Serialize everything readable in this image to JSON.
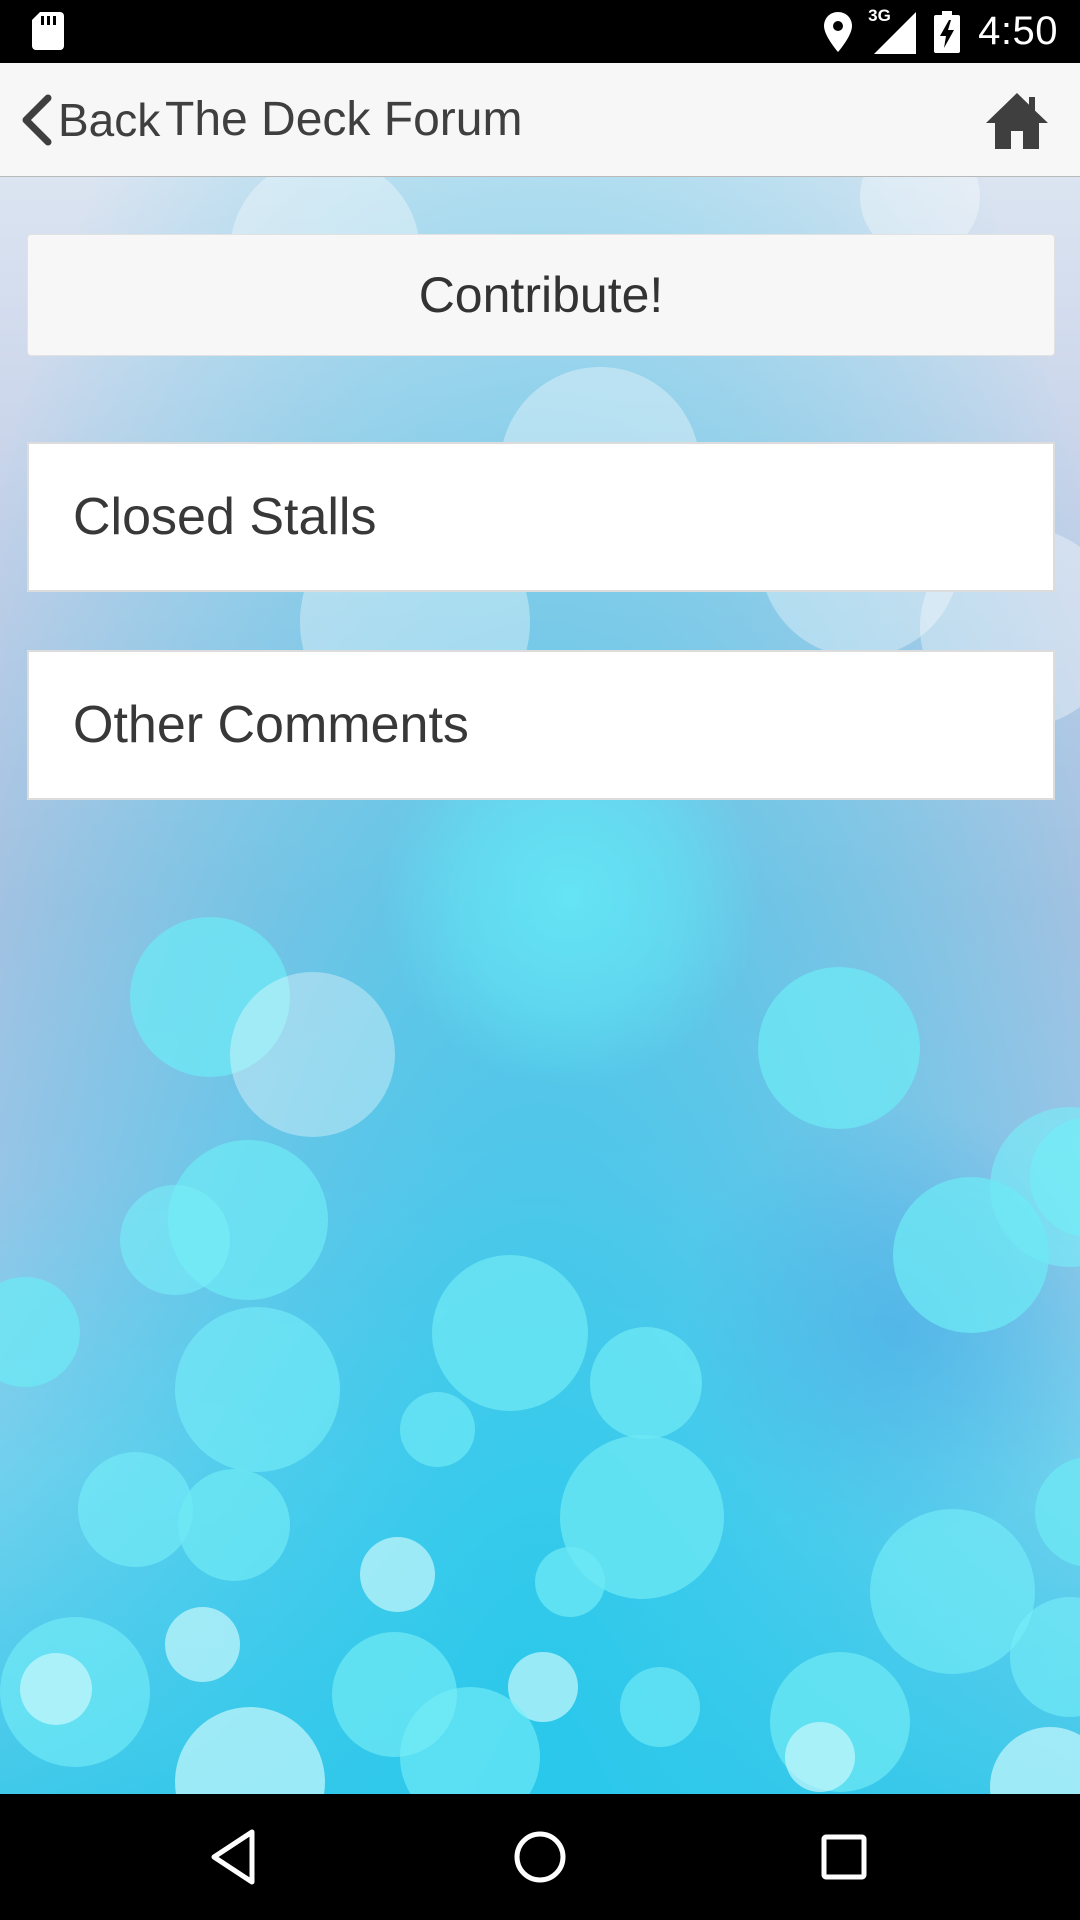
{
  "status_bar": {
    "time": "4:50",
    "network_type": "3G",
    "icons": [
      "sd-card-icon",
      "location-icon",
      "cell-signal-icon",
      "battery-charging-icon"
    ]
  },
  "action_bar": {
    "back_label": "Back",
    "title": "The Deck Forum",
    "home_icon": "home-icon"
  },
  "content": {
    "contribute_label": "Contribute!",
    "items": [
      {
        "label": "Closed Stalls"
      },
      {
        "label": "Other Comments"
      }
    ]
  },
  "nav_bar": {
    "icons": [
      "back-triangle-icon",
      "home-circle-icon",
      "recents-square-icon"
    ]
  },
  "colors": {
    "action_bar_bg": "#f7f7f7",
    "text": "#3f3f3f",
    "background_top": "#dbe4f1",
    "background_bottom": "#49c9ea"
  }
}
